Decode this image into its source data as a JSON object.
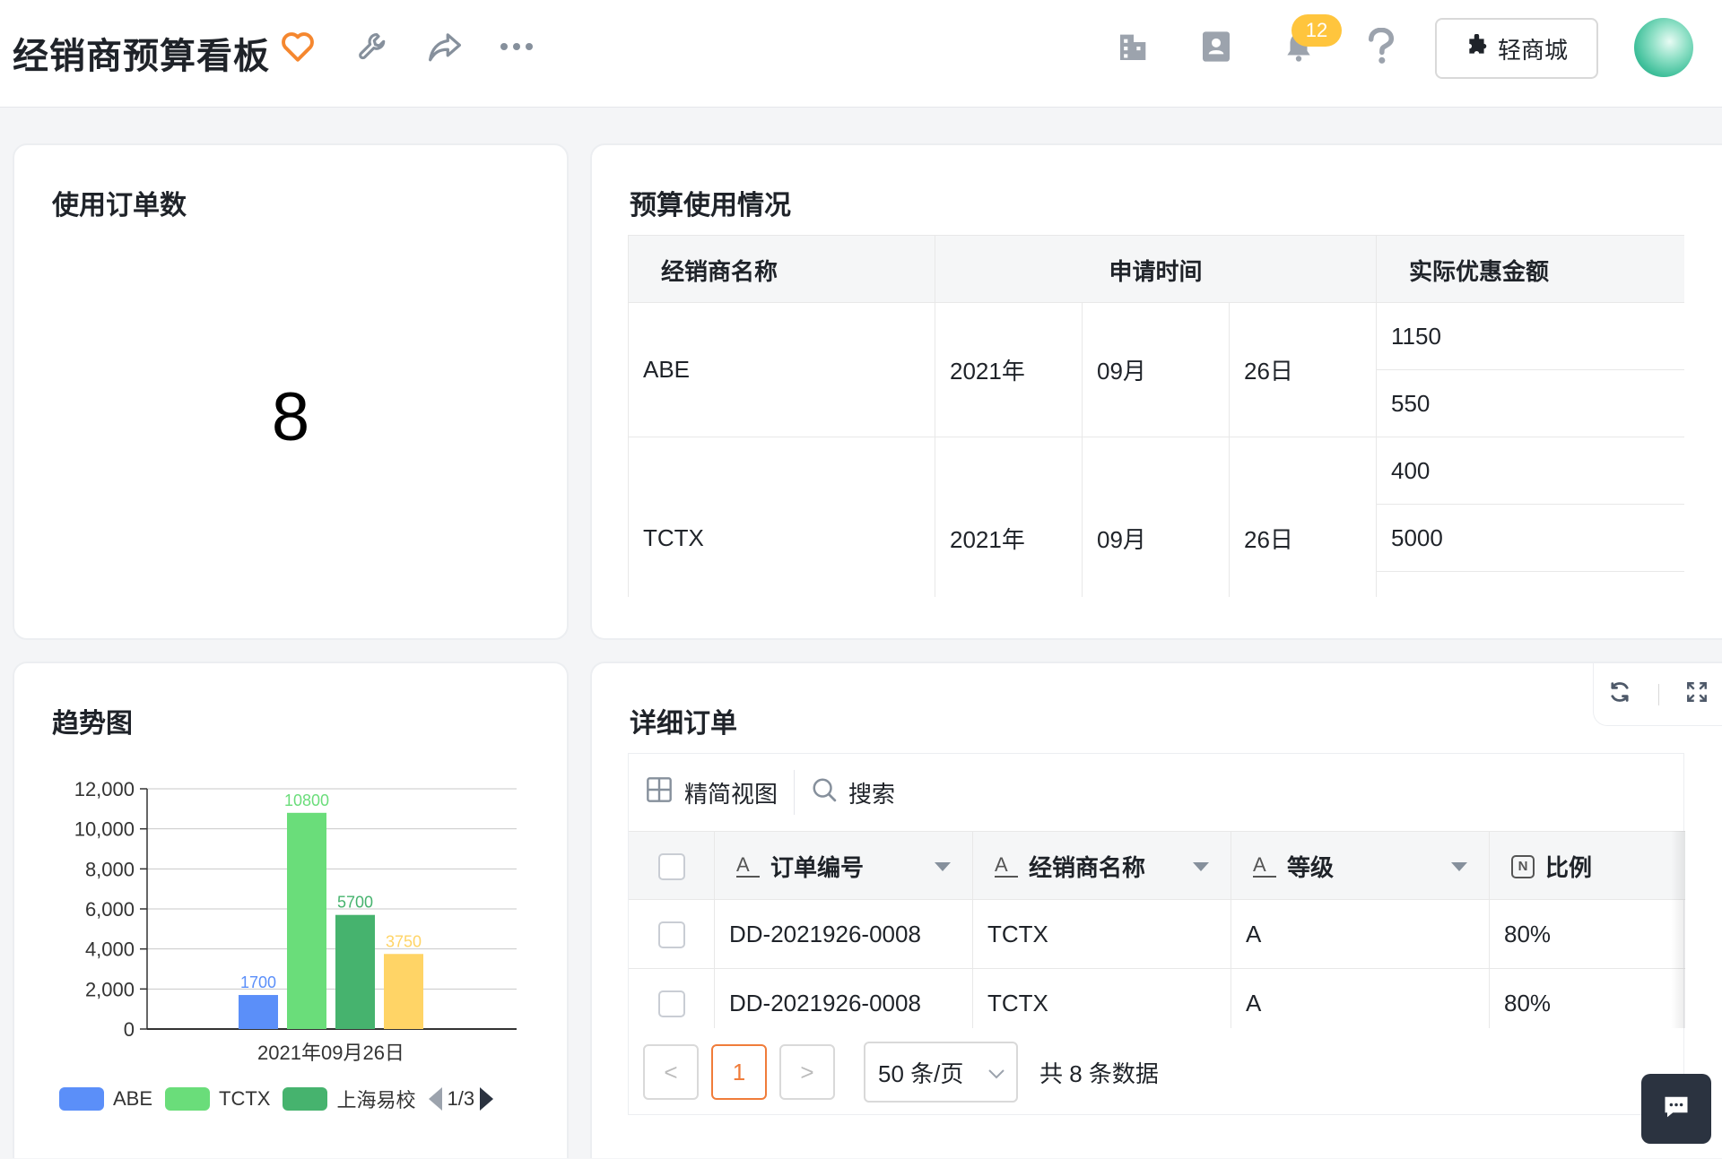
{
  "header": {
    "title": "经销商预算看板",
    "notification_count": "12",
    "mall_label": "轻商城",
    "icons": [
      "heart-icon",
      "wrench-icon",
      "share-icon",
      "more-icon",
      "building-icon",
      "contacts-icon",
      "bell-icon",
      "help-icon",
      "puzzle-icon"
    ]
  },
  "order_count": {
    "title": "使用订单数",
    "value": "8"
  },
  "budget": {
    "title": "预算使用情况",
    "headers": [
      "经销商名称",
      "申请时间",
      "实际优惠金额"
    ],
    "rows": [
      {
        "name": "ABE",
        "year": "2021年",
        "month": "09月",
        "day": "26日",
        "amounts": [
          "1150",
          "550"
        ]
      },
      {
        "name": "TCTX",
        "year": "2021年",
        "month": "09月",
        "day": "26日",
        "amounts": [
          "400",
          "5000"
        ]
      }
    ]
  },
  "trend": {
    "title": "趋势图",
    "legend_page": "1/3",
    "chart_data": {
      "type": "bar",
      "categories": [
        "2021年09月26日"
      ],
      "series": [
        {
          "name": "ABE",
          "values": [
            1700
          ],
          "color": "#5b8ff9"
        },
        {
          "name": "TCTX",
          "values": [
            10800
          ],
          "color": "#6add7a"
        },
        {
          "name": "上海易校",
          "values": [
            5700
          ],
          "color": "#46b36e"
        },
        {
          "name": "",
          "values": [
            3750
          ],
          "color": "#ffd466"
        }
      ],
      "yticks": [
        "12,000",
        "10,000",
        "8,000",
        "6,000",
        "4,000",
        "2,000",
        "0"
      ],
      "ylim": [
        0,
        12000
      ],
      "legend": "bottom",
      "grid": true
    }
  },
  "orders": {
    "title": "详细订单",
    "toolbar": {
      "view_label": "精简视图",
      "search_label": "搜索"
    },
    "columns": [
      "订单编号",
      "经销商名称",
      "等级",
      "比例"
    ],
    "rows": [
      {
        "order_no": "DD-2021926-0008",
        "dealer": "TCTX",
        "level": "A",
        "ratio": "80%"
      },
      {
        "order_no": "DD-2021926-0008",
        "dealer": "TCTX",
        "level": "A",
        "ratio": "80%"
      }
    ],
    "pagination": {
      "prev": "<",
      "current": "1",
      "next": ">",
      "page_size": "50 条/页",
      "total": "共 8 条数据"
    }
  }
}
